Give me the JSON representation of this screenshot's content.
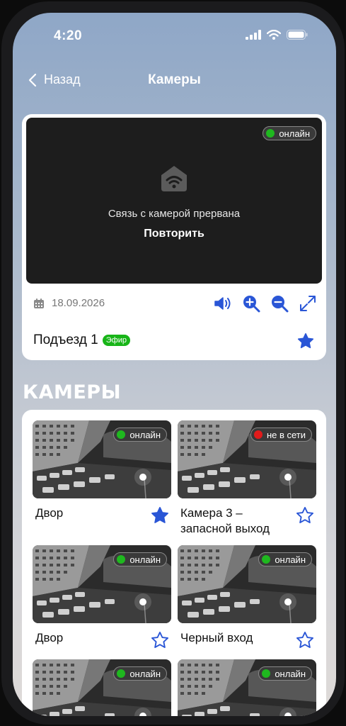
{
  "status_bar": {
    "time": "4:20"
  },
  "nav": {
    "back_label": "Назад",
    "title": "Камеры"
  },
  "main_camera": {
    "status": "онлайн",
    "message": "Связь с камерой прервана",
    "retry_label": "Повторить",
    "date": "18.09.2026",
    "name": "Подъезд 1",
    "live_label": "Эфир",
    "favorite": true
  },
  "section_title": "КАМЕРЫ",
  "cameras": [
    {
      "name": "Двор",
      "status": "онлайн",
      "online": true,
      "favorite": true
    },
    {
      "name": "Камера 3 – запасной выход",
      "status": "не в сети",
      "online": false,
      "favorite": false
    },
    {
      "name": "Двор",
      "status": "онлайн",
      "online": true,
      "favorite": false
    },
    {
      "name": "Черный вход",
      "status": "онлайн",
      "online": true,
      "favorite": false
    },
    {
      "name": "",
      "status": "онлайн",
      "online": true,
      "favorite": false
    },
    {
      "name": "",
      "status": "онлайн",
      "online": true,
      "favorite": false
    }
  ],
  "colors": {
    "accent": "#2a56d6",
    "online": "#1fb81f",
    "offline": "#e11b1b",
    "live": "#18b518"
  },
  "icons": {
    "back": "chevron-left-icon",
    "calendar": "calendar-icon",
    "volume": "volume-icon",
    "zoom_in": "zoom-in-icon",
    "zoom_out": "zoom-out-icon",
    "fullscreen": "expand-icon",
    "favorite": "star-icon",
    "no_signal": "wifi-house-icon"
  }
}
